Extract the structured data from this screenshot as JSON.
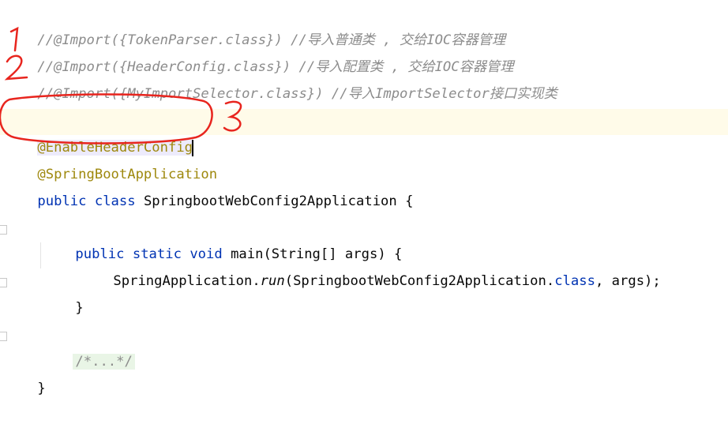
{
  "code": {
    "line1_comment": "//@Import({TokenParser.class}) //导入普通类 , 交给IOC容器管理",
    "line2_comment": "//@Import({HeaderConfig.class}) //导入配置类 , 交给IOC容器管理",
    "line3_comment": "//@Import({MyImportSelector.class}) //导入ImportSelector接口实现类",
    "enable_annotation": "@EnableHeaderConfig",
    "boot_annotation": "@SpringBootApplication",
    "class_kw_public": "public",
    "class_kw_class": "class",
    "class_name_decl": " SpringbootWebConfig2Application {",
    "main_kw_public": "public",
    "main_kw_static": "static",
    "main_kw_void": "void",
    "main_signature": " main(String[] args) {",
    "run_prefix": "SpringApplication.",
    "run_method": "run",
    "run_args_1": "(SpringbootWebConfig2Application.",
    "run_class_kw": "class",
    "run_args_2": ", args);",
    "close_brace_method": "}",
    "folded_comment": "/*...*/",
    "close_brace_class": "}"
  },
  "annotations": {
    "mark_1": "1",
    "mark_2": "2",
    "mark_3": "3",
    "color": "#e8251e"
  },
  "colors": {
    "comment": "#8c8c8c",
    "annotation": "#9e880d",
    "keyword": "#0033b3",
    "caret_line": "#fffbe9"
  }
}
